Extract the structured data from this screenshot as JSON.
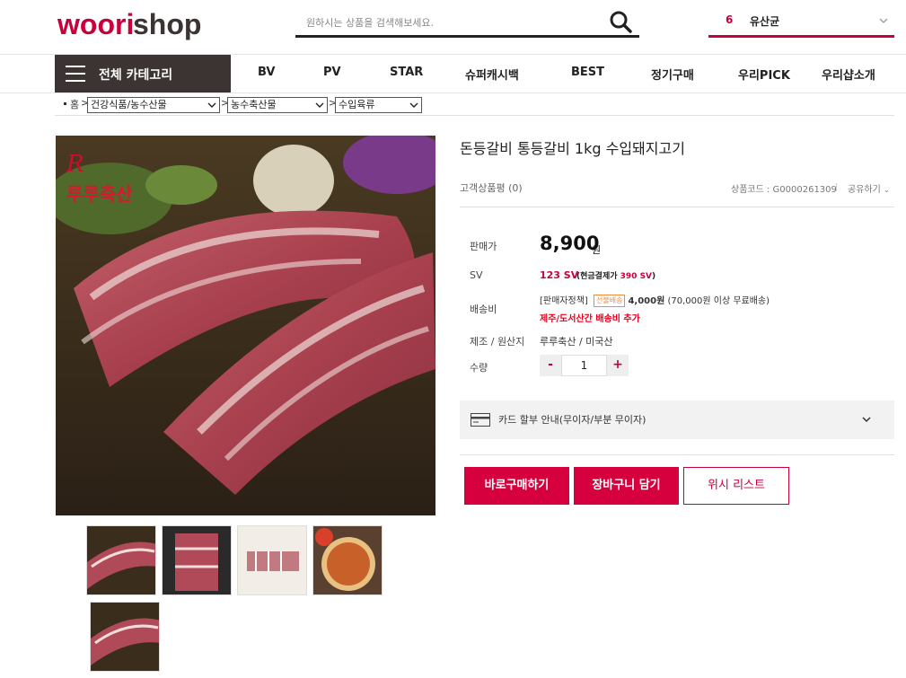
{
  "header": {
    "search_placeholder": "원하시는 상품을 검색해보세요.",
    "cart_count": "6",
    "cart_label": "유산균"
  },
  "nav": {
    "all_categories": "전체 카테고리",
    "items": [
      "BV",
      "PV",
      "STAR",
      "슈퍼캐시백",
      "BEST",
      "정기구매",
      "우리PICK",
      "우리샵소개"
    ]
  },
  "breadcrumb": {
    "home": "홈",
    "sep": ">",
    "levels": [
      "건강식품/농수산물",
      "농수축산물",
      "수입육류"
    ]
  },
  "product": {
    "title": "돈등갈비 통등갈비 1kg 수입돼지고기",
    "review": "고객상품평 (0)",
    "code": "상품코드 : G0000261309",
    "share": "공유하기",
    "brand_watermark": "루루축산",
    "price_label": "판매가",
    "price": "8,900",
    "price_unit": "원",
    "sv_label": "SV",
    "sv_value": "123 SV",
    "sv_cash_prefix": "(현금결제가 ",
    "sv_cash_value": "390 SV",
    "sv_cash_suffix": ")",
    "shipping_label": "배송비",
    "shipping_policy": "[판매자정책]",
    "shipping_badge": "선불배송",
    "shipping_fee": "4,000원",
    "shipping_condition": "(70,000원 이상 무료배송)",
    "shipping_extra": "제주/도서산간 배송비 추가",
    "origin_label": "제조 / 원산지",
    "origin_value": "루루축산 / 미국산",
    "qty_label": "수량",
    "qty_value": "1",
    "qty_minus": "-",
    "qty_plus": "+",
    "card_info": "카드 할부 안내(무이자/부분 무이자)",
    "buy_now": "바로구매하기",
    "add_cart": "장바구니 담기",
    "wishlist": "위시 리스트"
  },
  "colors": {
    "accent": "#d6003e",
    "nav_dark": "#3b3433"
  }
}
